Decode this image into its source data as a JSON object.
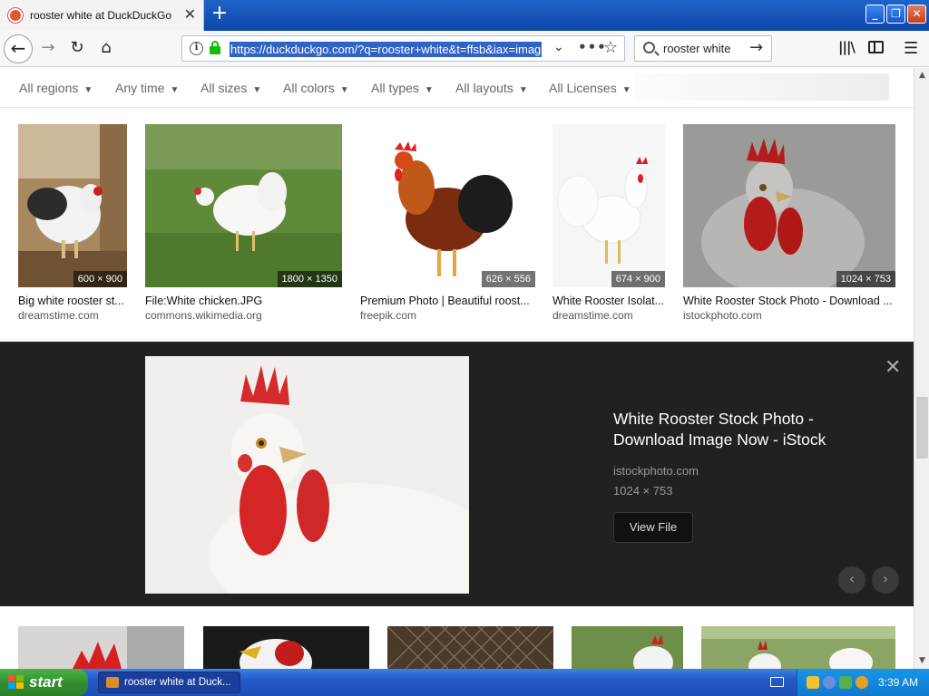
{
  "browser": {
    "tab_title": "rooster white at DuckDuckGo",
    "url": "https://duckduckgo.com/?q=rooster+white&t=ffsb&iax=imag",
    "search_text": "rooster white"
  },
  "filters": [
    {
      "label": "All regions"
    },
    {
      "label": "Any time"
    },
    {
      "label": "All sizes"
    },
    {
      "label": "All colors"
    },
    {
      "label": "All types"
    },
    {
      "label": "All layouts"
    },
    {
      "label": "All Licenses"
    }
  ],
  "results": [
    {
      "dims": "600 × 900",
      "caption": "Big white rooster st...",
      "source": "dreamstime.com"
    },
    {
      "dims": "1800 × 1350",
      "caption": "File:White chicken.JPG",
      "source": "commons.wikimedia.org"
    },
    {
      "dims": "626 × 556",
      "caption": "Premium Photo | Beautiful roost...",
      "source": "freepik.com"
    },
    {
      "dims": "674 × 900",
      "caption": "White Rooster Isolat...",
      "source": "dreamstime.com"
    },
    {
      "dims": "1024 × 753",
      "caption": "White Rooster Stock Photo - Download ...",
      "source": "istockphoto.com"
    }
  ],
  "detail": {
    "title": "White Rooster Stock Photo - Download Image Now - iStock",
    "source": "istockphoto.com",
    "dims": "1024 × 753",
    "view_file_label": "View File"
  },
  "taskbar": {
    "start_label": "start",
    "task_label": "rooster white at Duck...",
    "clock": "3:39 AM"
  },
  "colors": {
    "accent": "#3163c7",
    "secure_green": "#12bc00",
    "detail_bg": "#212121",
    "taskbar_blue": "#2459c7",
    "start_green": "#338f2f"
  }
}
